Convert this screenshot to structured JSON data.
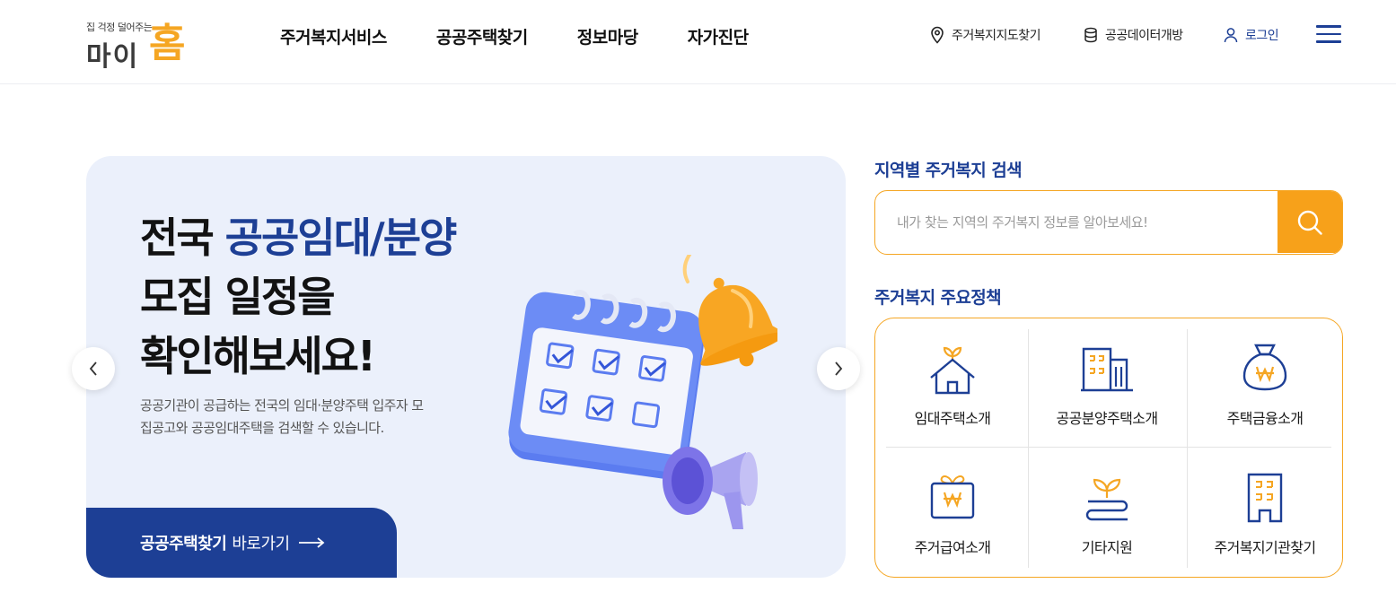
{
  "header": {
    "logo": {
      "tagline": "집 걱정 덜어주는",
      "mai": "마이",
      "home": "홈"
    },
    "nav": [
      {
        "label": "주거복지서비스"
      },
      {
        "label": "공공주택찾기"
      },
      {
        "label": "정보마당"
      },
      {
        "label": "자가진단"
      }
    ],
    "util": {
      "map": "주거복지지도찾기",
      "data": "공공데이터개방",
      "login": "로그인"
    }
  },
  "banner": {
    "title_line1_a": "전국 ",
    "title_line1_b": "공공임대/분양",
    "title_line2": "모집 일정을",
    "title_line3": "확인해보세요!",
    "desc": "공공기관이 공급하는 전국의 임대·분양주택 입주자 모집공고와 공공임대주택을 검색할 수 있습니다.",
    "cta_bold": "공공주택찾기",
    "cta_rest": "바로가기"
  },
  "search": {
    "title": "지역별 주거복지 검색",
    "placeholder": "내가 찾는 지역의 주거복지 정보를 알아보세요!"
  },
  "policy": {
    "title": "주거복지 주요정책",
    "items": [
      {
        "label": "임대주택소개",
        "icon": "house-sprout-icon"
      },
      {
        "label": "공공분양주택소개",
        "icon": "buildings-icon"
      },
      {
        "label": "주택금융소개",
        "icon": "money-bag-icon"
      },
      {
        "label": "주거급여소개",
        "icon": "gift-won-icon"
      },
      {
        "label": "기타지원",
        "icon": "sprout-icon"
      },
      {
        "label": "주거복지기관찾기",
        "icon": "building-icon"
      }
    ]
  },
  "colors": {
    "navy": "#1d3f95",
    "orange": "#f5a623",
    "banner_bg": "#ebf0fb"
  }
}
